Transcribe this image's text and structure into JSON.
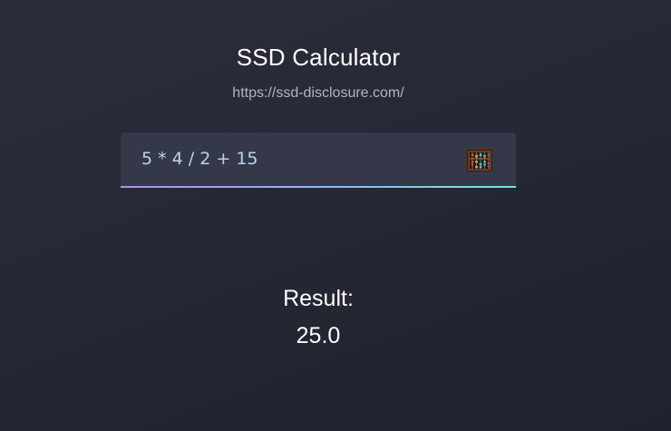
{
  "app": {
    "title": "SSD Calculator",
    "url": "https://ssd-disclosure.com/"
  },
  "calculator": {
    "expression_value": "5 * 4 / 2 + 15",
    "icon": "abacus-icon"
  },
  "result": {
    "label": "Result:",
    "value": "25.0"
  },
  "colors": {
    "background": "#262836",
    "input_background": "#353849",
    "underline_start": "#b28cf2",
    "underline_end": "#6ee7e6",
    "input_text": "#b9d3f0",
    "subtitle_text": "#b2b4c6"
  }
}
